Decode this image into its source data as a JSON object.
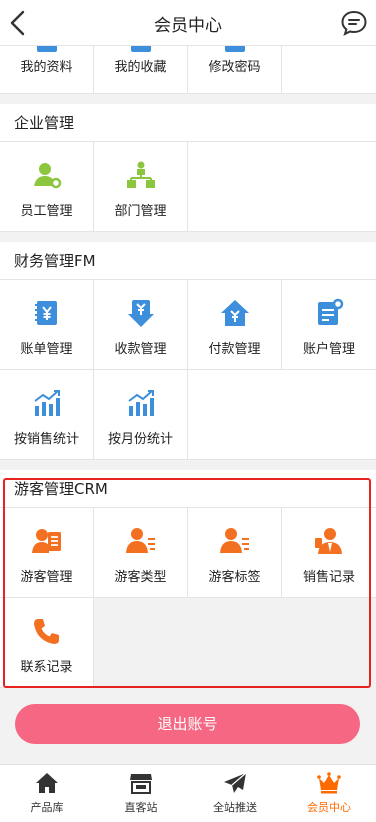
{
  "header": {
    "title": "会员中心",
    "back_icon": "chevron-left-icon",
    "message_icon": "chat-bubble-icon"
  },
  "account": {
    "items": [
      {
        "label": "我的资料"
      },
      {
        "label": "我的收藏"
      },
      {
        "label": "修改密码"
      }
    ]
  },
  "enterprise": {
    "title": "企业管理",
    "items": [
      {
        "label": "员工管理",
        "icon": "employee-gear-icon"
      },
      {
        "label": "部门管理",
        "icon": "org-chart-icon"
      }
    ]
  },
  "finance": {
    "title": "财务管理FM",
    "items": [
      {
        "label": "账单管理",
        "icon": "bill-yen-icon"
      },
      {
        "label": "收款管理",
        "icon": "receive-yen-icon"
      },
      {
        "label": "付款管理",
        "icon": "payment-house-icon"
      },
      {
        "label": "账户管理",
        "icon": "account-doc-gear-icon"
      },
      {
        "label": "按销售统计",
        "icon": "bar-chart-trend-icon"
      },
      {
        "label": "按月份统计",
        "icon": "bar-chart-trend-icon"
      }
    ]
  },
  "crm": {
    "title": "游客管理CRM",
    "items": [
      {
        "label": "游客管理",
        "icon": "visitor-card-icon"
      },
      {
        "label": "游客类型",
        "icon": "person-list-icon"
      },
      {
        "label": "游客标签",
        "icon": "person-list-icon"
      },
      {
        "label": "销售记录",
        "icon": "sales-person-icon"
      },
      {
        "label": "联系记录",
        "icon": "phone-icon"
      }
    ]
  },
  "logout": {
    "label": "退出账号"
  },
  "tabbar": {
    "items": [
      {
        "label": "产品库",
        "icon": "house-icon"
      },
      {
        "label": "直客站",
        "icon": "storefront-icon"
      },
      {
        "label": "全站推送",
        "icon": "paper-plane-icon"
      },
      {
        "label": "会员中心",
        "icon": "crown-icon"
      }
    ],
    "active": "会员中心"
  },
  "colors": {
    "accent": "#ff6a00",
    "green": "#8cc63f",
    "blue": "#3d8fdb",
    "logout": "#f56782",
    "highlight": "#e8231f"
  }
}
